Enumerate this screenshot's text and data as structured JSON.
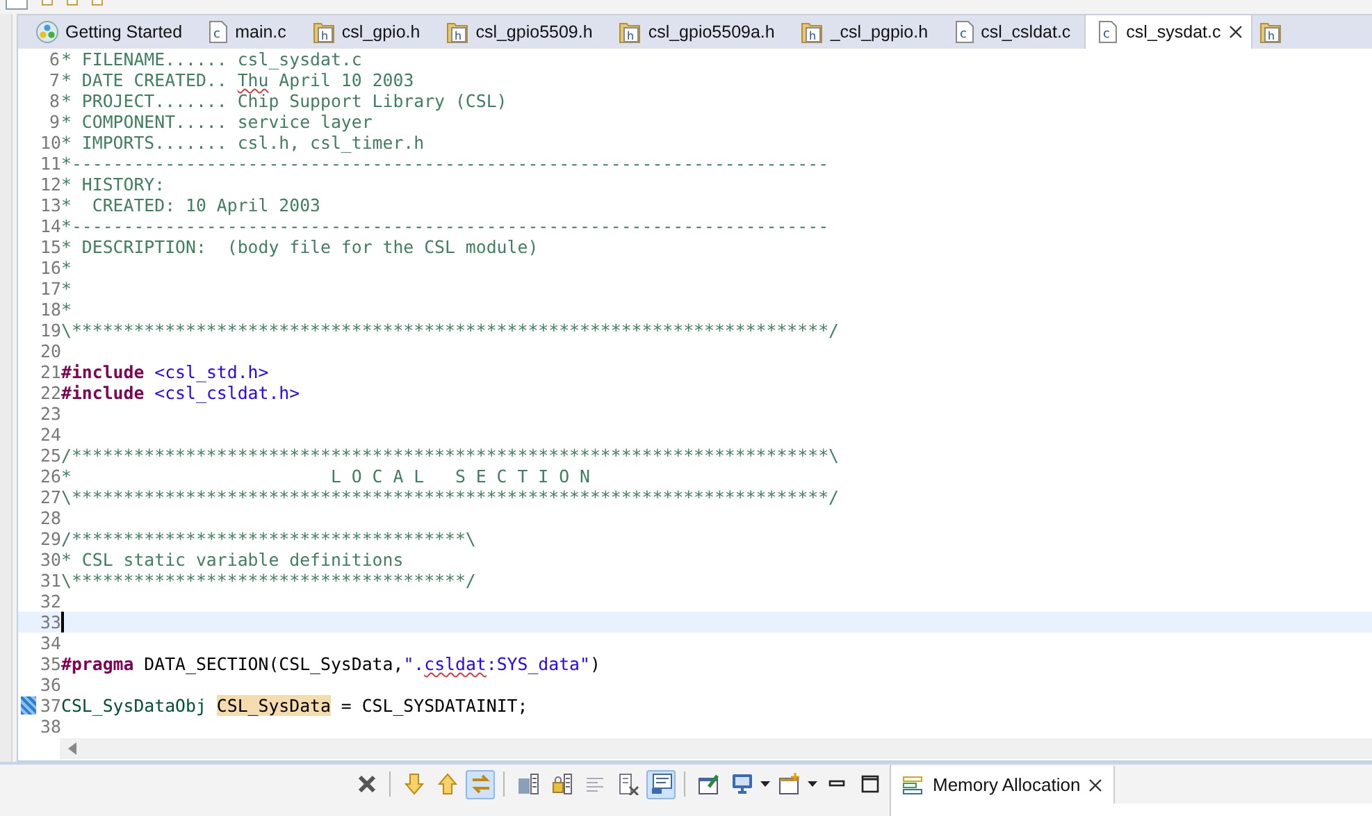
{
  "editor_tabs": [
    {
      "label": "Getting Started",
      "kind": "app",
      "selected": false,
      "closable": false
    },
    {
      "label": "main.c",
      "kind": "c",
      "selected": false,
      "closable": false
    },
    {
      "label": "csl_gpio.h",
      "kind": "h",
      "selected": false,
      "closable": false
    },
    {
      "label": "csl_gpio5509.h",
      "kind": "h",
      "selected": false,
      "closable": false
    },
    {
      "label": "csl_gpio5509a.h",
      "kind": "h",
      "selected": false,
      "closable": false
    },
    {
      "label": "_csl_pgpio.h",
      "kind": "h",
      "selected": false,
      "closable": false
    },
    {
      "label": "csl_csldat.c",
      "kind": "c",
      "selected": false,
      "closable": false
    },
    {
      "label": "csl_sysdat.c",
      "kind": "c",
      "selected": true,
      "closable": true
    },
    {
      "kind": "h",
      "selected": false,
      "closable": false
    }
  ],
  "code_lines": [
    {
      "number": "6",
      "current": false,
      "bookmark": false,
      "segments": [
        {
          "text": "* FILENAME...... csl_sysdat.c",
          "kind": "comment"
        }
      ]
    },
    {
      "number": "7",
      "current": false,
      "bookmark": false,
      "segments": [
        {
          "text": "* DATE CREATED.. ",
          "kind": "comment"
        },
        {
          "text": "Thu",
          "kind": "comment-misspelled"
        },
        {
          "text": " April 10 2003",
          "kind": "comment"
        }
      ]
    },
    {
      "number": "8",
      "current": false,
      "bookmark": false,
      "segments": [
        {
          "text": "* PROJECT....... Chip Support Library (CSL)",
          "kind": "comment"
        }
      ]
    },
    {
      "number": "9",
      "current": false,
      "bookmark": false,
      "segments": [
        {
          "text": "* COMPONENT..... service layer",
          "kind": "comment"
        }
      ]
    },
    {
      "number": "10",
      "current": false,
      "bookmark": false,
      "segments": [
        {
          "text": "* IMPORTS....... csl.h, csl_timer.h",
          "kind": "comment"
        }
      ]
    },
    {
      "number": "11",
      "current": false,
      "bookmark": false,
      "segments": [
        {
          "text": "*-------------------------------------------------------------------------",
          "kind": "comment"
        }
      ]
    },
    {
      "number": "12",
      "current": false,
      "bookmark": false,
      "segments": [
        {
          "text": "* HISTORY:",
          "kind": "comment"
        }
      ]
    },
    {
      "number": "13",
      "current": false,
      "bookmark": false,
      "segments": [
        {
          "text": "*  CREATED: 10 April 2003",
          "kind": "comment"
        }
      ]
    },
    {
      "number": "14",
      "current": false,
      "bookmark": false,
      "segments": [
        {
          "text": "*-------------------------------------------------------------------------",
          "kind": "comment"
        }
      ]
    },
    {
      "number": "15",
      "current": false,
      "bookmark": false,
      "segments": [
        {
          "text": "* DESCRIPTION:  (body file for the CSL module)",
          "kind": "comment"
        }
      ]
    },
    {
      "number": "16",
      "current": false,
      "bookmark": false,
      "segments": [
        {
          "text": "*",
          "kind": "comment"
        }
      ]
    },
    {
      "number": "17",
      "current": false,
      "bookmark": false,
      "segments": [
        {
          "text": "*",
          "kind": "comment"
        }
      ]
    },
    {
      "number": "18",
      "current": false,
      "bookmark": false,
      "segments": [
        {
          "text": "*",
          "kind": "comment"
        }
      ]
    },
    {
      "number": "19",
      "current": false,
      "bookmark": false,
      "segments": [
        {
          "text": "\\*************************************************************************/",
          "kind": "comment"
        }
      ]
    },
    {
      "number": "20",
      "current": false,
      "bookmark": false
    },
    {
      "number": "21",
      "current": false,
      "bookmark": false,
      "segments": [
        {
          "text": "#include ",
          "kind": "keyword"
        },
        {
          "text": "<csl_std.h>",
          "kind": "include"
        }
      ]
    },
    {
      "number": "22",
      "current": false,
      "bookmark": false,
      "segments": [
        {
          "text": "#include ",
          "kind": "keyword"
        },
        {
          "text": "<csl_csldat.h>",
          "kind": "include"
        }
      ]
    },
    {
      "number": "23",
      "current": false,
      "bookmark": false
    },
    {
      "number": "24",
      "current": false,
      "bookmark": false
    },
    {
      "number": "25",
      "current": false,
      "bookmark": false,
      "segments": [
        {
          "text": "/*************************************************************************\\",
          "kind": "comment"
        }
      ]
    },
    {
      "number": "26",
      "current": false,
      "bookmark": false,
      "segments": [
        {
          "text": "*                         L O C A L   S E C T I O N",
          "kind": "comment"
        }
      ]
    },
    {
      "number": "27",
      "current": false,
      "bookmark": false,
      "segments": [
        {
          "text": "\\*************************************************************************/",
          "kind": "comment"
        }
      ]
    },
    {
      "number": "28",
      "current": false,
      "bookmark": false
    },
    {
      "number": "29",
      "current": false,
      "bookmark": false,
      "segments": [
        {
          "text": "/**************************************\\",
          "kind": "comment"
        }
      ]
    },
    {
      "number": "30",
      "current": false,
      "bookmark": false,
      "segments": [
        {
          "text": "* CSL static variable definitions",
          "kind": "comment"
        }
      ]
    },
    {
      "number": "31",
      "current": false,
      "bookmark": false,
      "segments": [
        {
          "text": "\\**************************************/",
          "kind": "comment"
        }
      ]
    },
    {
      "number": "32",
      "current": false,
      "bookmark": false
    },
    {
      "number": "33",
      "current": true,
      "bookmark": false
    },
    {
      "number": "34",
      "current": false,
      "bookmark": false
    },
    {
      "number": "35",
      "current": false,
      "bookmark": false,
      "segments": [
        {
          "text": "#pragma",
          "kind": "keyword"
        },
        {
          "text": " DATA_SECTION(CSL_SysData,",
          "kind": "plain"
        },
        {
          "text": "\".",
          "kind": "string"
        },
        {
          "text": "csldat",
          "kind": "string-misspelled"
        },
        {
          "text": ":SYS_data\"",
          "kind": "string"
        },
        {
          "text": ")",
          "kind": "plain"
        }
      ]
    },
    {
      "number": "36",
      "current": false,
      "bookmark": false
    },
    {
      "number": "37",
      "current": false,
      "bookmark": true,
      "segments": [
        {
          "text": "CSL_SysDataObj ",
          "kind": "type"
        },
        {
          "text": "CSL_SysData",
          "kind": "occurrence"
        },
        {
          "text": " = CSL_SYSDATAINIT;",
          "kind": "plain"
        }
      ]
    },
    {
      "number": "38",
      "current": false,
      "bookmark": false
    }
  ],
  "view_toolbar": [
    {
      "kind": "remove-all",
      "pressed": false,
      "dropdown": false
    },
    {
      "kind": "separator"
    },
    {
      "kind": "arrow-down",
      "pressed": false,
      "dropdown": false
    },
    {
      "kind": "arrow-up",
      "pressed": false,
      "dropdown": false
    },
    {
      "kind": "link",
      "pressed": true,
      "dropdown": false
    },
    {
      "kind": "separator"
    },
    {
      "kind": "memory-map",
      "pressed": false,
      "dropdown": false
    },
    {
      "kind": "memory-lock",
      "pressed": false,
      "dropdown": false
    },
    {
      "kind": "lines",
      "pressed": false,
      "dropdown": false
    },
    {
      "kind": "doc-remove",
      "pressed": false,
      "dropdown": false
    },
    {
      "kind": "console",
      "pressed": true,
      "dropdown": false
    },
    {
      "kind": "separator"
    },
    {
      "kind": "pin",
      "pressed": false,
      "dropdown": false
    },
    {
      "kind": "monitor",
      "pressed": false,
      "dropdown": true
    },
    {
      "kind": "new-window",
      "pressed": false,
      "dropdown": true
    },
    {
      "kind": "minimize",
      "pressed": false,
      "dropdown": false
    },
    {
      "kind": "maximize",
      "pressed": false,
      "dropdown": false
    }
  ],
  "view_tab": {
    "label": "Memory Allocation",
    "selected": true,
    "closable": true
  }
}
